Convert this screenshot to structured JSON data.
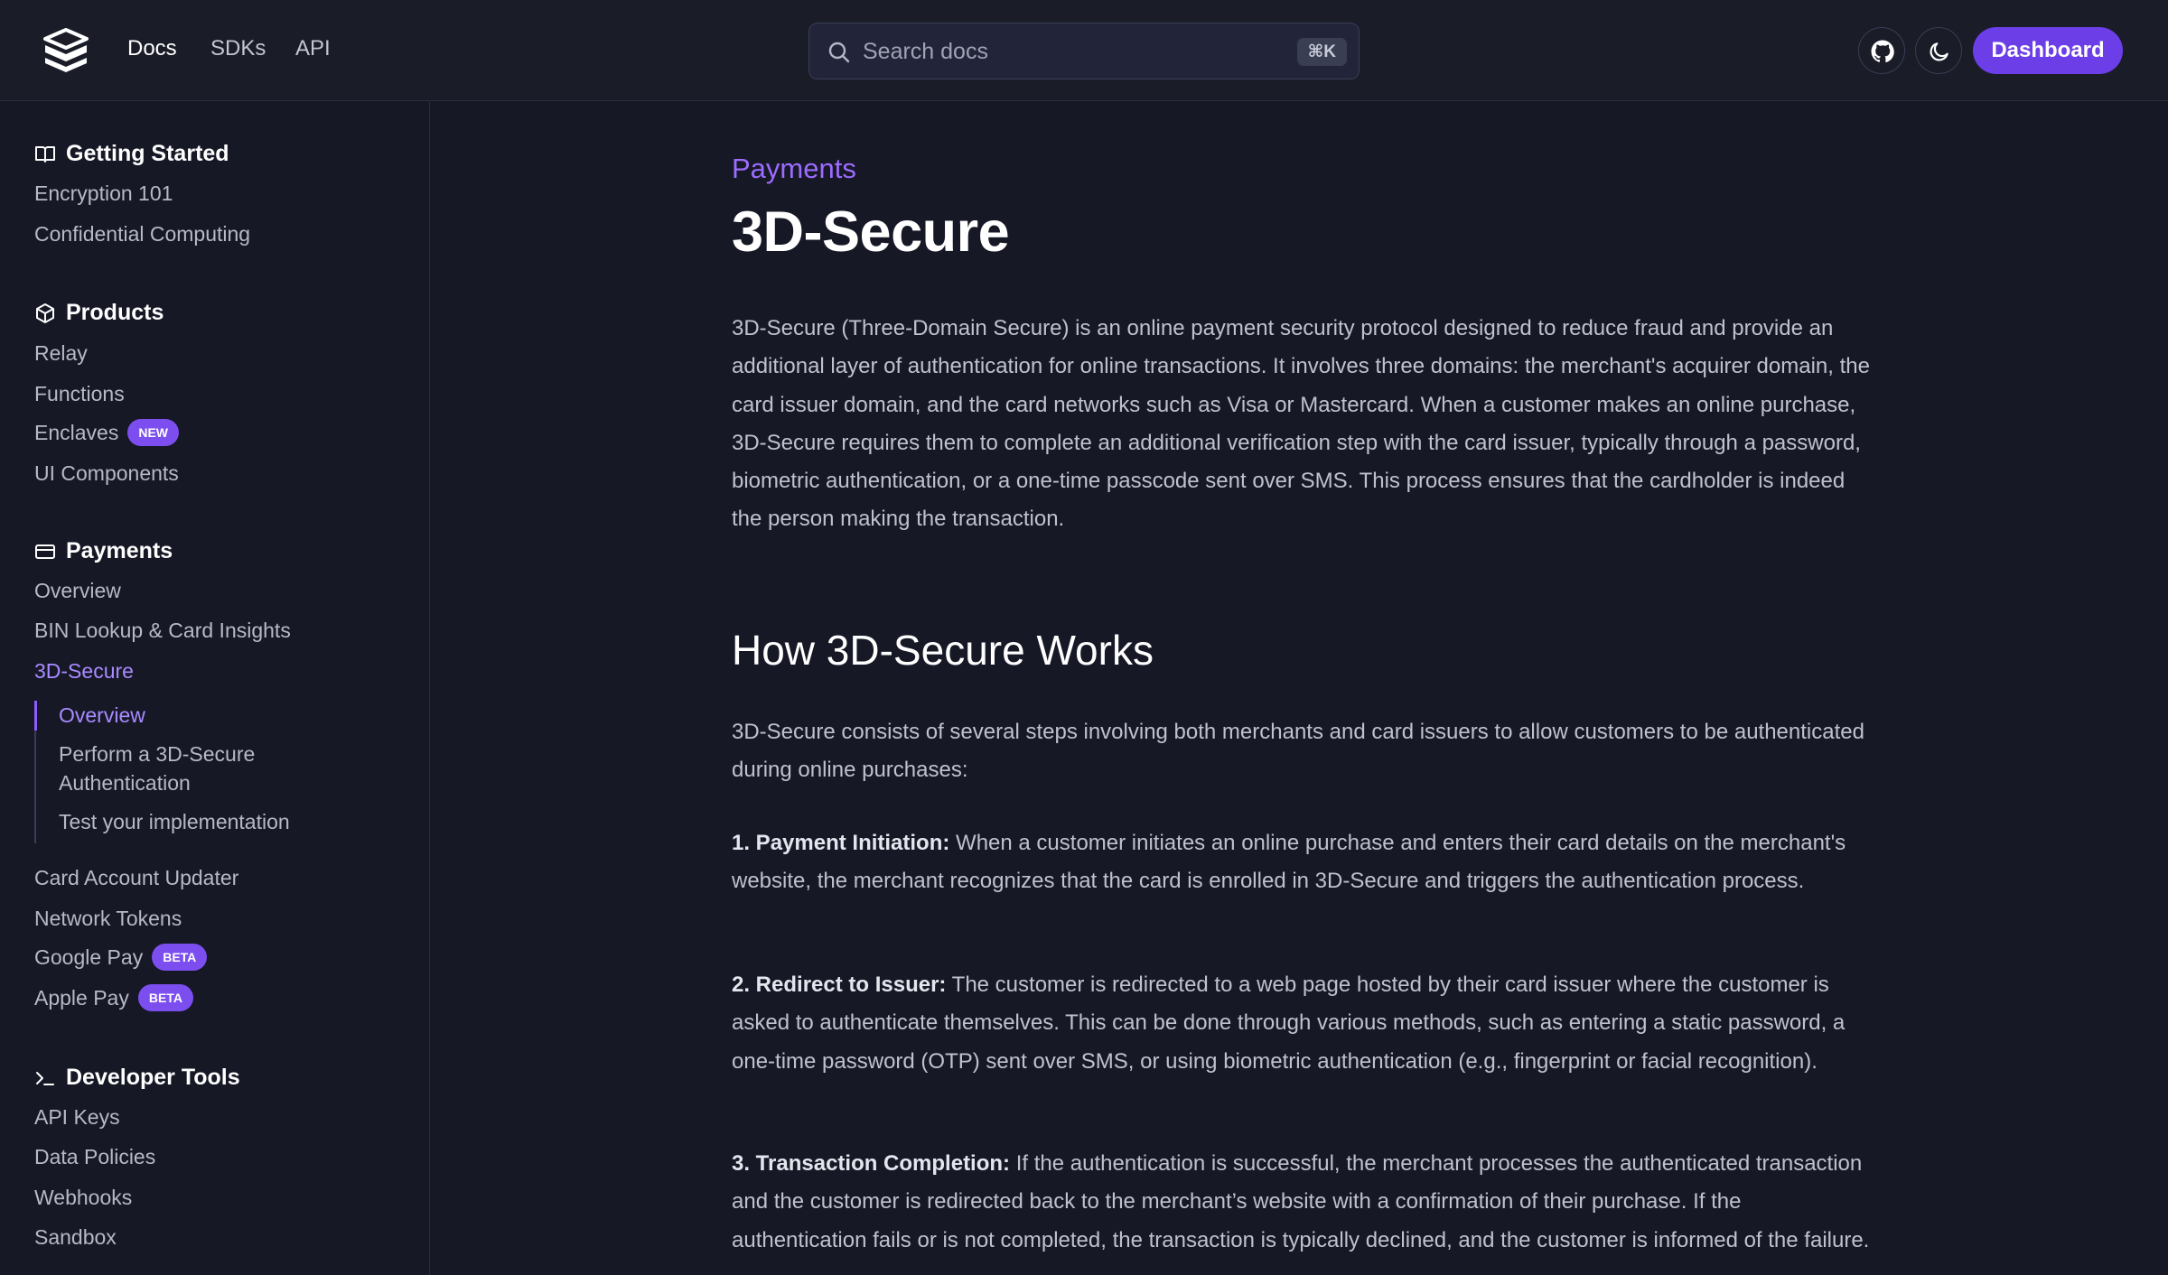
{
  "topbar": {
    "nav": [
      "Docs",
      "SDKs",
      "API"
    ],
    "search_placeholder": "Search docs",
    "search_shortcut": "⌘K",
    "dashboard_label": "Dashboard"
  },
  "sidebar": {
    "getting_started": {
      "title": "Getting Started",
      "items": [
        "Encryption 101",
        "Confidential Computing"
      ]
    },
    "products": {
      "title": "Products",
      "items": [
        "Relay",
        "Functions",
        "Enclaves",
        "UI Components"
      ],
      "enclaves_badge": "NEW"
    },
    "payments": {
      "title": "Payments",
      "items": [
        "Overview",
        "BIN Lookup & Card Insights",
        "3D-Secure"
      ],
      "sub_items": [
        "Overview",
        "Perform a 3D-Secure Authentication",
        "Test your implementation"
      ],
      "more_items": [
        "Card Account Updater",
        "Network Tokens",
        "Google Pay",
        "Apple Pay"
      ],
      "badge": "BETA"
    },
    "developer_tools": {
      "title": "Developer Tools",
      "items": [
        "API Keys",
        "Data Policies",
        "Webhooks",
        "Sandbox"
      ]
    }
  },
  "main": {
    "eyebrow": "Payments",
    "title": "3D-Secure",
    "intro": "3D-Secure (Three-Domain Secure) is an online payment security protocol designed to reduce fraud and provide an additional layer of authentication for online transactions. It involves three domains: the merchant's acquirer domain, the card issuer domain, and the card networks such as Visa or Mastercard. When a customer makes an online purchase, 3D-Secure requires them to complete an additional verification step with the card issuer, typically through a password, biometric authentication, or a one-time passcode sent over SMS. This process ensures that the cardholder is indeed the person making the transaction.",
    "section_title": "How 3D-Secure Works",
    "section_intro": "3D-Secure consists of several steps involving both merchants and card issuers to allow customers to be authenticated during online purchases:",
    "steps": [
      {
        "label": "1. Payment Initiation:",
        "text": " When a customer initiates an online purchase and enters their card details on the merchant's website, the merchant recognizes that the card is enrolled in 3D-Secure and triggers the authentication process."
      },
      {
        "label": "2. Redirect to Issuer:",
        "text": " The customer is redirected to a web page hosted by their card issuer where the customer is asked to authenticate themselves. This can be done through various methods, such as entering a static password, a one-time password (OTP) sent over SMS, or using biometric authentication (e.g., fingerprint or facial recognition)."
      },
      {
        "label": "3. Transaction Completion:",
        "text": " If the authentication is successful, the merchant processes the authenticated transaction and the customer is redirected back to the merchant’s website with a confirmation of their purchase. If the authentication fails or is not completed, the transaction is typically declined, and the customer is informed of the failure."
      }
    ]
  },
  "colors": {
    "accent": "#6c3ee8",
    "active_link": "#a98bff",
    "background": "#161826"
  }
}
